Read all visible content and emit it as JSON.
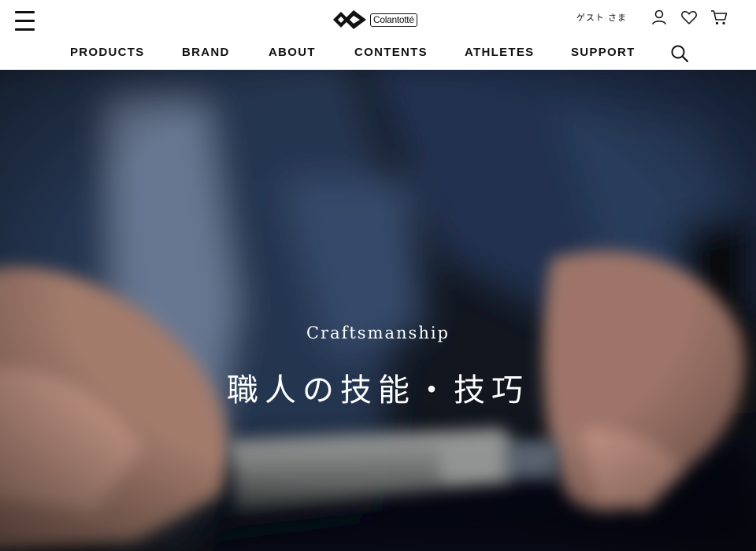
{
  "header": {
    "logo_text": "Colantotté",
    "guest_label": "ゲスト さま",
    "icons": [
      "menu-icon",
      "logo-mark-icon",
      "user-icon",
      "heart-icon",
      "cart-icon",
      "search-icon"
    ]
  },
  "nav": {
    "items": [
      {
        "label": "PRODUCTS"
      },
      {
        "label": "BRAND"
      },
      {
        "label": "ABOUT"
      },
      {
        "label": "CONTENTS"
      },
      {
        "label": "ATHLETES"
      },
      {
        "label": "SUPPORT"
      }
    ]
  },
  "hero": {
    "eyebrow": "Craftsmanship",
    "title": "職人の技能・技巧"
  },
  "colors": {
    "text": "#111111",
    "header_bg": "#ffffff",
    "hero_text": "#ffffff"
  }
}
